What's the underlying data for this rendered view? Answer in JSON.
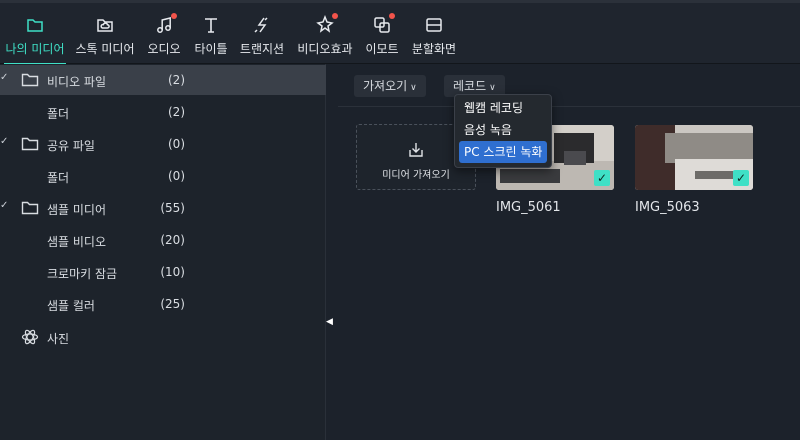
{
  "toolbar": {
    "items": [
      {
        "label": "나의 미디어",
        "icon": "folder-icon",
        "active": true
      },
      {
        "label": "스톡 미디어",
        "icon": "cloud-folder-icon"
      },
      {
        "label": "오디오",
        "icon": "music-note-icon",
        "badge": true
      },
      {
        "label": "타이틀",
        "icon": "text-t-icon"
      },
      {
        "label": "트랜지션",
        "icon": "transition-icon"
      },
      {
        "label": "비디오효과",
        "icon": "effects-sparkle-icon",
        "badge": true
      },
      {
        "label": "이모트",
        "icon": "emote-icon",
        "badge": true
      },
      {
        "label": "분할화면",
        "icon": "split-screen-icon"
      }
    ]
  },
  "sidebar": {
    "items": [
      {
        "label": "비디오 파일",
        "count": "(2)",
        "expanded": true,
        "folder": true,
        "selected": true
      },
      {
        "label": "폴더",
        "count": "(2)"
      },
      {
        "label": "공유 파일",
        "count": "(0)",
        "expanded": true,
        "folder": true
      },
      {
        "label": "폴더",
        "count": "(0)"
      },
      {
        "label": "샘플 미디어",
        "count": "(55)",
        "expanded": true,
        "folder": true
      },
      {
        "label": "샘플 비디오",
        "count": "(20)"
      },
      {
        "label": "크로마키 잠금",
        "count": "(10)"
      },
      {
        "label": "샘플 컬러",
        "count": "(25)"
      },
      {
        "label": "사진",
        "icon": "atom-photo-icon"
      }
    ]
  },
  "content": {
    "import_button": "가져오기",
    "record_button": "레코드",
    "import_tile_label": "미디어 가져오기",
    "media": [
      {
        "name": "IMG_5061",
        "checked": true
      },
      {
        "name": "IMG_5063",
        "checked": true
      }
    ]
  },
  "record_menu": {
    "items": [
      {
        "label": "웹캠 레코딩"
      },
      {
        "label": "음성 녹음"
      },
      {
        "label": "PC 스크린 녹화",
        "highlighted": true
      }
    ]
  },
  "colors": {
    "accent": "#3fe0c6",
    "badge": "#f2544b",
    "menu_highlight": "#2f6fd0",
    "selected_row": "#3a4049"
  }
}
